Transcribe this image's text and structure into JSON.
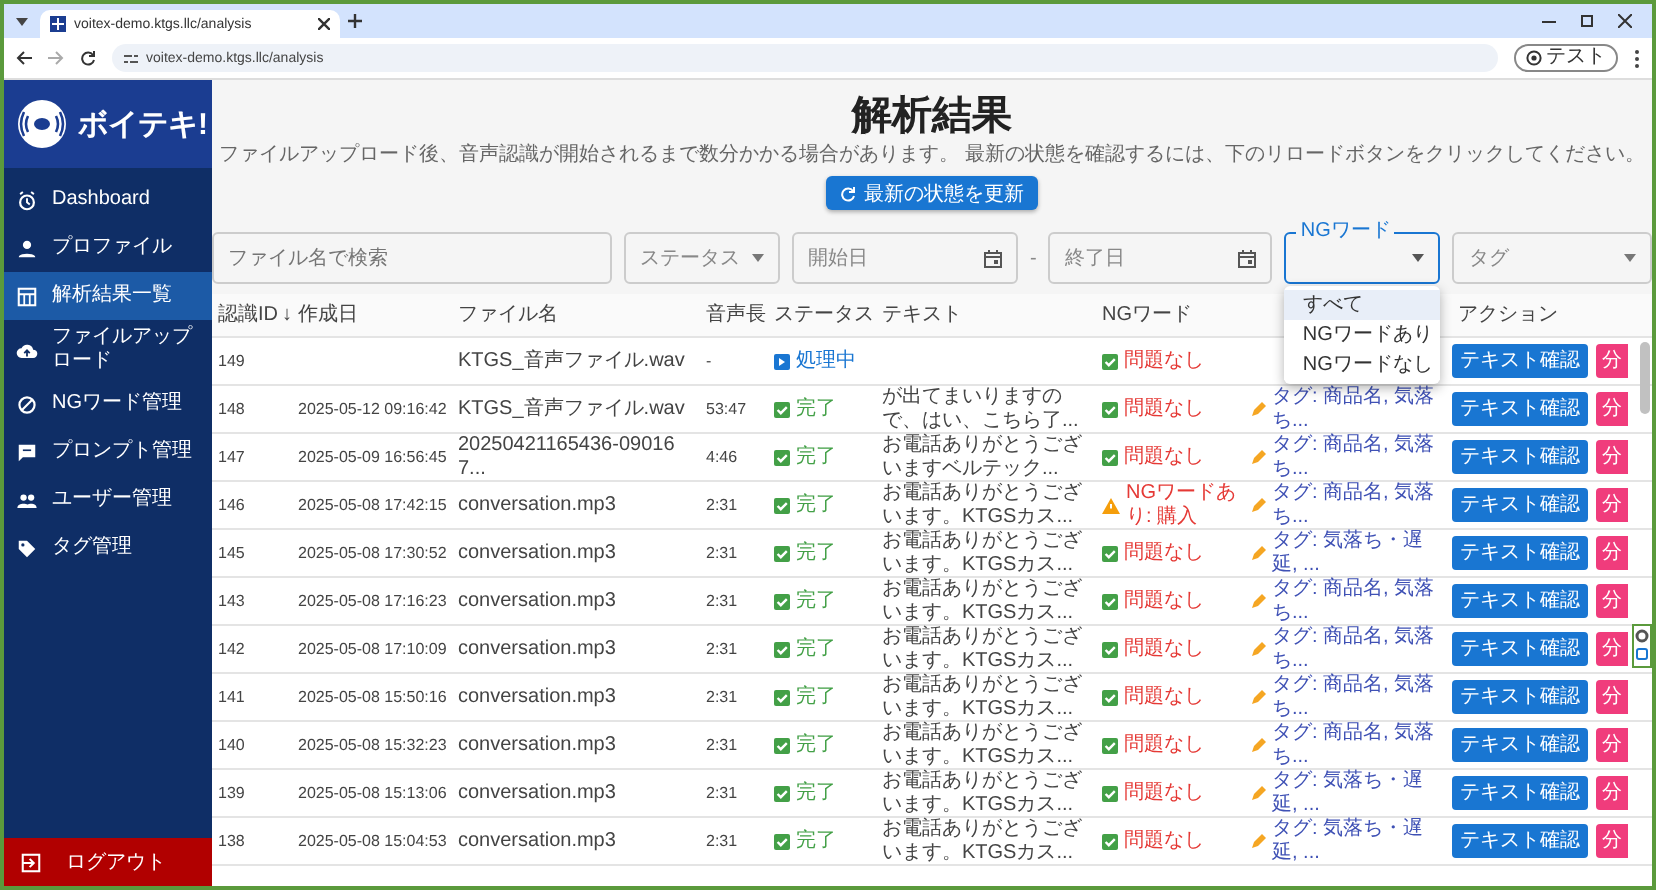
{
  "browser": {
    "tab_title": "voitex-demo.ktgs.llc/analysis",
    "url": "voitex-demo.ktgs.llc/analysis",
    "profile": "テスト"
  },
  "sidebar": {
    "logo": "ボイテキ!",
    "items": [
      {
        "label": "Dashboard",
        "selected": false
      },
      {
        "label": "プロファイル",
        "selected": false
      },
      {
        "label": "解析結果一覧",
        "selected": true
      },
      {
        "label": "ファイルアップロード",
        "selected": false
      },
      {
        "label": "NGワード管理",
        "selected": false
      },
      {
        "label": "プロンプト管理",
        "selected": false
      },
      {
        "label": "ユーザー管理",
        "selected": false
      },
      {
        "label": "タグ管理",
        "selected": false
      }
    ],
    "logout": "ログアウト"
  },
  "page": {
    "title": "解析結果",
    "description": "ファイルアップロード後、音声認識が開始されるまで数分かかる場合があります。 最新の状態を確認するには、下のリロードボタンをクリックしてください。",
    "refresh_button": "最新の状態を更新"
  },
  "filters": {
    "search_placeholder": "ファイル名で検索",
    "status_placeholder": "ステータス",
    "start_placeholder": "開始日",
    "separator": "-",
    "end_placeholder": "終了日",
    "ng": {
      "label": "NGワード",
      "focused": true,
      "expanded": true,
      "options": [
        {
          "label": "すべて",
          "selected": true
        },
        {
          "label": "NGワードあり",
          "selected": false
        },
        {
          "label": "NGワードなし",
          "selected": false
        }
      ]
    },
    "tag_placeholder": "タグ"
  },
  "table": {
    "columns": [
      {
        "label": "認識ID",
        "sort_arrow": "↓"
      },
      {
        "label": "作成日"
      },
      {
        "label": "ファイル名"
      },
      {
        "label": "音声長"
      },
      {
        "label": "ステータス"
      },
      {
        "label": "テキスト"
      },
      {
        "label": "NGワード"
      },
      null,
      {
        "label": "アクション"
      }
    ],
    "rows": [
      {
        "id": "149",
        "file": "KTGS_音声ファイル.wav",
        "duration": "-",
        "status": {
          "kind": "processing",
          "label": "処理中"
        },
        "ng": {
          "kind": "ok",
          "label": "問題なし"
        },
        "actions": [
          "テキスト確認",
          "分"
        ]
      },
      {
        "id": "148",
        "created": "2025-05-12 09:16:42",
        "file": "KTGS_音声ファイル.wav",
        "duration": "53:47",
        "status": {
          "kind": "done",
          "label": "完了"
        },
        "text": "が出てまいりますので、はい、こちら了...",
        "ng": {
          "kind": "ok",
          "label": "問題なし"
        },
        "tag": "タグ: 商品名, 気落ち...",
        "actions": [
          "テキスト確認",
          "分"
        ]
      },
      {
        "id": "147",
        "created": "2025-05-09 16:56:45",
        "file": "20250421165436-090167...",
        "duration": "4:46",
        "status": {
          "kind": "done",
          "label": "完了"
        },
        "text": "お電話ありがとうございますベルテック...",
        "ng": {
          "kind": "ok",
          "label": "問題なし"
        },
        "tag": "タグ: 商品名, 気落ち...",
        "actions": [
          "テキスト確認",
          "分"
        ]
      },
      {
        "id": "146",
        "created": "2025-05-08 17:42:15",
        "file": "conversation.mp3",
        "duration": "2:31",
        "status": {
          "kind": "done",
          "label": "完了"
        },
        "text": "お電話ありがとうございます。KTGSカス...",
        "ng": {
          "kind": "ng",
          "label": "NGワードあり: 購入"
        },
        "tag": "タグ: 商品名, 気落ち...",
        "actions": [
          "テキスト確認",
          "分"
        ]
      },
      {
        "id": "145",
        "created": "2025-05-08 17:30:52",
        "file": "conversation.mp3",
        "duration": "2:31",
        "status": {
          "kind": "done",
          "label": "完了"
        },
        "text": "お電話ありがとうございます。KTGSカス...",
        "ng": {
          "kind": "ok",
          "label": "問題なし"
        },
        "tag": "タグ: 気落ち・遅延, ...",
        "actions": [
          "テキスト確認",
          "分"
        ]
      },
      {
        "id": "143",
        "created": "2025-05-08 17:16:23",
        "file": "conversation.mp3",
        "duration": "2:31",
        "status": {
          "kind": "done",
          "label": "完了"
        },
        "text": "お電話ありがとうございます。KTGSカス...",
        "ng": {
          "kind": "ok",
          "label": "問題なし"
        },
        "tag": "タグ: 商品名, 気落ち...",
        "actions": [
          "テキスト確認",
          "分"
        ]
      },
      {
        "id": "142",
        "created": "2025-05-08 17:10:09",
        "file": "conversation.mp3",
        "duration": "2:31",
        "status": {
          "kind": "done",
          "label": "完了"
        },
        "text": "お電話ありがとうございます。KTGSカス...",
        "ng": {
          "kind": "ok",
          "label": "問題なし"
        },
        "tag": "タグ: 商品名, 気落ち...",
        "actions": [
          "テキスト確認",
          "分"
        ]
      },
      {
        "id": "141",
        "created": "2025-05-08 15:50:16",
        "file": "conversation.mp3",
        "duration": "2:31",
        "status": {
          "kind": "done",
          "label": "完了"
        },
        "text": "お電話ありがとうございます。KTGSカス...",
        "ng": {
          "kind": "ok",
          "label": "問題なし"
        },
        "tag": "タグ: 商品名, 気落ち...",
        "actions": [
          "テキスト確認",
          "分"
        ]
      },
      {
        "id": "140",
        "created": "2025-05-08 15:32:23",
        "file": "conversation.mp3",
        "duration": "2:31",
        "status": {
          "kind": "done",
          "label": "完了"
        },
        "text": "お電話ありがとうございます。KTGSカス...",
        "ng": {
          "kind": "ok",
          "label": "問題なし"
        },
        "tag": "タグ: 商品名, 気落ち...",
        "actions": [
          "テキスト確認",
          "分"
        ]
      },
      {
        "id": "139",
        "created": "2025-05-08 15:13:06",
        "file": "conversation.mp3",
        "duration": "2:31",
        "status": {
          "kind": "done",
          "label": "完了"
        },
        "text": "お電話ありがとうございます。KTGSカス...",
        "ng": {
          "kind": "ok",
          "label": "問題なし"
        },
        "tag": "タグ: 気落ち・遅延, ...",
        "actions": [
          "テキスト確認",
          "分"
        ]
      },
      {
        "id": "138",
        "created": "2025-05-08 15:04:53",
        "file": "conversation.mp3",
        "duration": "2:31",
        "status": {
          "kind": "done",
          "label": "完了"
        },
        "text": "お電話ありがとうございます。KTGSカス...",
        "ng": {
          "kind": "ok",
          "label": "問題なし"
        },
        "tag": "タグ: 気落ち・遅延, ...",
        "actions": [
          "テキスト確認",
          "分"
        ]
      }
    ]
  }
}
